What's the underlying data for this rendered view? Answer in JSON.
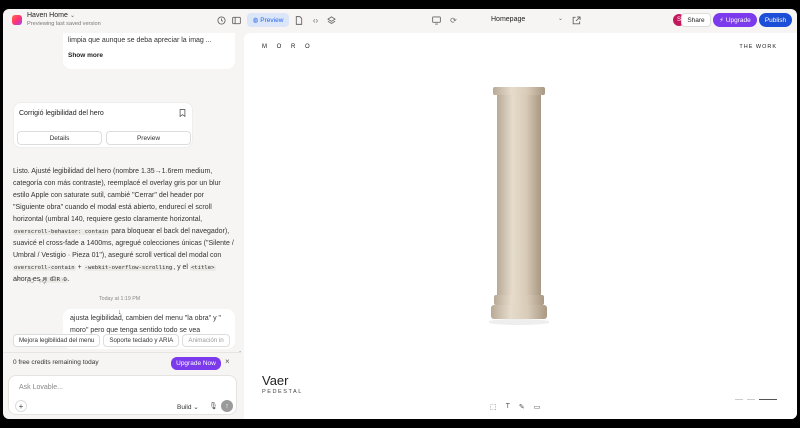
{
  "topbar": {
    "project_name": "Haven Home",
    "project_subtitle": "Previewing last saved version",
    "preview_label": "Preview",
    "route": "Homepage",
    "avatar_initial": "S",
    "share_label": "Share",
    "upgrade_label": "Upgrade",
    "publish_label": "Publish"
  },
  "chat": {
    "prev_card": {
      "text": "limpia que aunque se deba apreciar la imag ...",
      "show_more": "Show more"
    },
    "fix_card": {
      "title": "Corrigió legibilidad del hero",
      "details_label": "Details",
      "preview_label": "Preview"
    },
    "message": {
      "p1": "Listo. Ajusté legibilidad del hero (nombre 1.35→1.6rem medium, categoría con más contraste), reemplacé el overlay gris por un blur estilo Apple con saturate sutil, cambié \"Cerrar\" del header por \"Siguiente obra\" cuando el modal está abierto, endurecí el scroll horizontal (umbral 140, requiere gesto claramente horizontal,",
      "code1": "overscroll-behavior: contain",
      "p2": "para bloquear el back del navegador), suavicé el cross-fade a 1400ms, agregué colecciones únicas (\"Silente / Umbral / Vestigio · Pieza 01\"), aseguré scroll vertical del modal con",
      "code2": "overscroll-contain",
      "p3": "+",
      "code3": "-webkit-overflow-scrolling",
      "p4": ", y el",
      "code4": "<title>",
      "p5": "ahora es",
      "code5": "M O R O",
      "p6": "."
    },
    "timestamp": "Today at 1:19 PM",
    "user_message": "ajusta legibilidad, cambien del menu \"la obra\" y \" moro\" pero que tenga sentido todo se vea",
    "chips": [
      "Mejora legibilidad del menu",
      "Soporte teclado y ARIA",
      "Animación in"
    ],
    "credits_text": "0 free credits remaining today",
    "upgrade_now_label": "Upgrade Now",
    "input_placeholder": "Ask Lovable...",
    "build_label": "Build"
  },
  "site": {
    "logo": "M O R O",
    "nav": "THE WORK",
    "work_title": "Vaer",
    "work_subtitle": "PEDESTAL"
  },
  "icons": {
    "brand_gradient": [
      "#ff6a3d",
      "#ff2f7a",
      "#8f4dff"
    ],
    "accent_purple": "#7c3aed",
    "accent_blue": "#1d4ed8"
  }
}
